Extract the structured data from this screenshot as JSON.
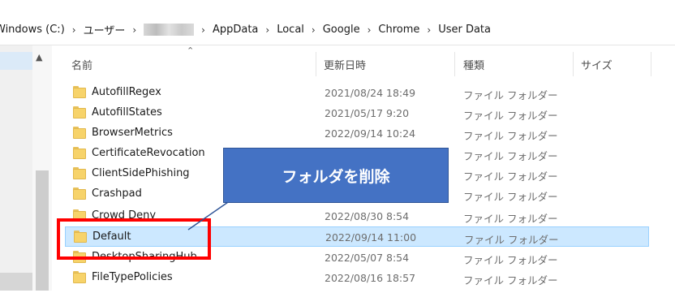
{
  "breadcrumb": {
    "items": [
      "Windows (C:)",
      "ユーザー",
      "AppData",
      "Local",
      "Google",
      "Chrome",
      "User Data"
    ],
    "separator": "›"
  },
  "columns": {
    "name": "名前",
    "date": "更新日時",
    "type": "種類",
    "size": "サイズ"
  },
  "files": [
    {
      "name": "AutofillRegex",
      "date": "2021/08/24 18:49",
      "type": "ファイル フォルダー"
    },
    {
      "name": "AutofillStates",
      "date": "2021/05/17 9:20",
      "type": "ファイル フォルダー"
    },
    {
      "name": "BrowserMetrics",
      "date": "2022/09/14 10:24",
      "type": "ファイル フォルダー"
    },
    {
      "name": "CertificateRevocation",
      "date": "",
      "type": "ファイル フォルダー"
    },
    {
      "name": "ClientSidePhishing",
      "date": "",
      "type": "ファイル フォルダー"
    },
    {
      "name": "Crashpad",
      "date": "",
      "type": "ファイル フォルダー"
    },
    {
      "name": "Crowd Deny",
      "date": "2022/08/30 8:54",
      "type": "ファイル フォルダー"
    },
    {
      "name": "Default",
      "date": "2022/09/14 11:00",
      "type": "ファイル フォルダー"
    },
    {
      "name": "DesktopSharingHub",
      "date": "2022/05/07 8:54",
      "type": "ファイル フォルダー"
    },
    {
      "name": "FileTypePolicies",
      "date": "2022/08/16 18:57",
      "type": "ファイル フォルダー"
    }
  ],
  "callout": {
    "text": "フォルダを削除"
  },
  "colors": {
    "selected_row": "#cce8ff",
    "callout": "#4472c4",
    "highlight": "#ff0000"
  }
}
